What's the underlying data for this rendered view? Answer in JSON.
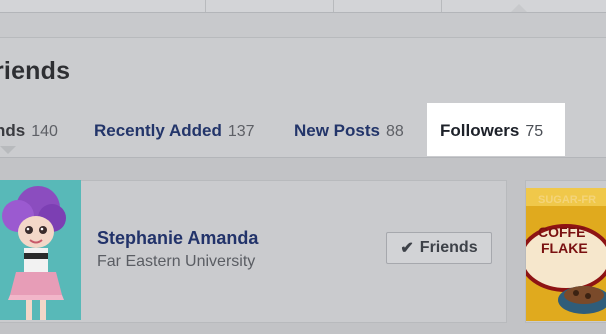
{
  "section": {
    "title": "riends"
  },
  "tabs": [
    {
      "label": "nds",
      "count": "140"
    },
    {
      "label": "Recently Added",
      "count": "137"
    },
    {
      "label": "New Posts",
      "count": "88"
    },
    {
      "label": "Followers",
      "count": "75"
    }
  ],
  "friend": {
    "name": "Stephanie Amanda",
    "subtitle": "Far Eastern University",
    "button_label": "Friends"
  },
  "thumbnail_text": {
    "top": "SUGAR-FR",
    "line1": "COFFE",
    "line2": "FLAKE"
  },
  "icons": {
    "friends_button_check": "check-icon",
    "tab_indicator": "triangle-icon"
  },
  "colors": {
    "title": "#2e2f33",
    "link": "#23356a",
    "highlight": "#ffffff"
  }
}
